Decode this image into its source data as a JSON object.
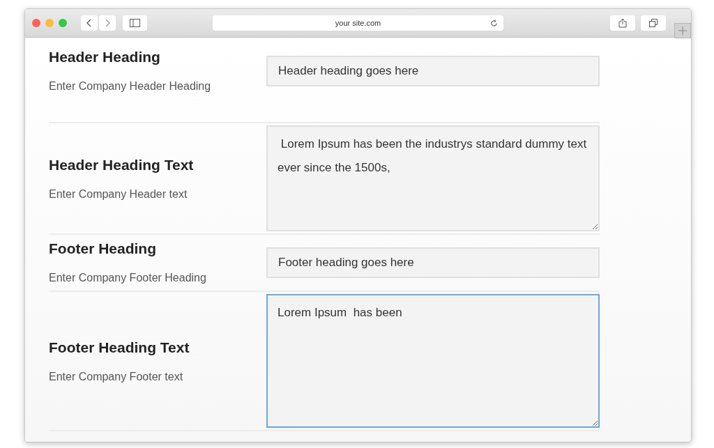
{
  "browser": {
    "address": "your site.com"
  },
  "rows": [
    {
      "heading": "Header Heading",
      "description": "Enter Company Header Heading",
      "kind": "input",
      "value": "Header heading goes here",
      "focused": false
    },
    {
      "heading": "Header Heading Text",
      "description": "Enter Company Header text",
      "kind": "textarea",
      "value": " Lorem Ipsum has been the industrys standard dummy text ever since the 1500s,",
      "focused": false
    },
    {
      "heading": "Footer Heading",
      "description": "Enter Company Footer Heading",
      "kind": "input",
      "value": "Footer heading goes here",
      "focused": false
    },
    {
      "heading": "Footer Heading Text",
      "description": "Enter Company Footer text",
      "kind": "textarea",
      "value": "Lorem Ipsum  has been",
      "focused": true
    }
  ]
}
